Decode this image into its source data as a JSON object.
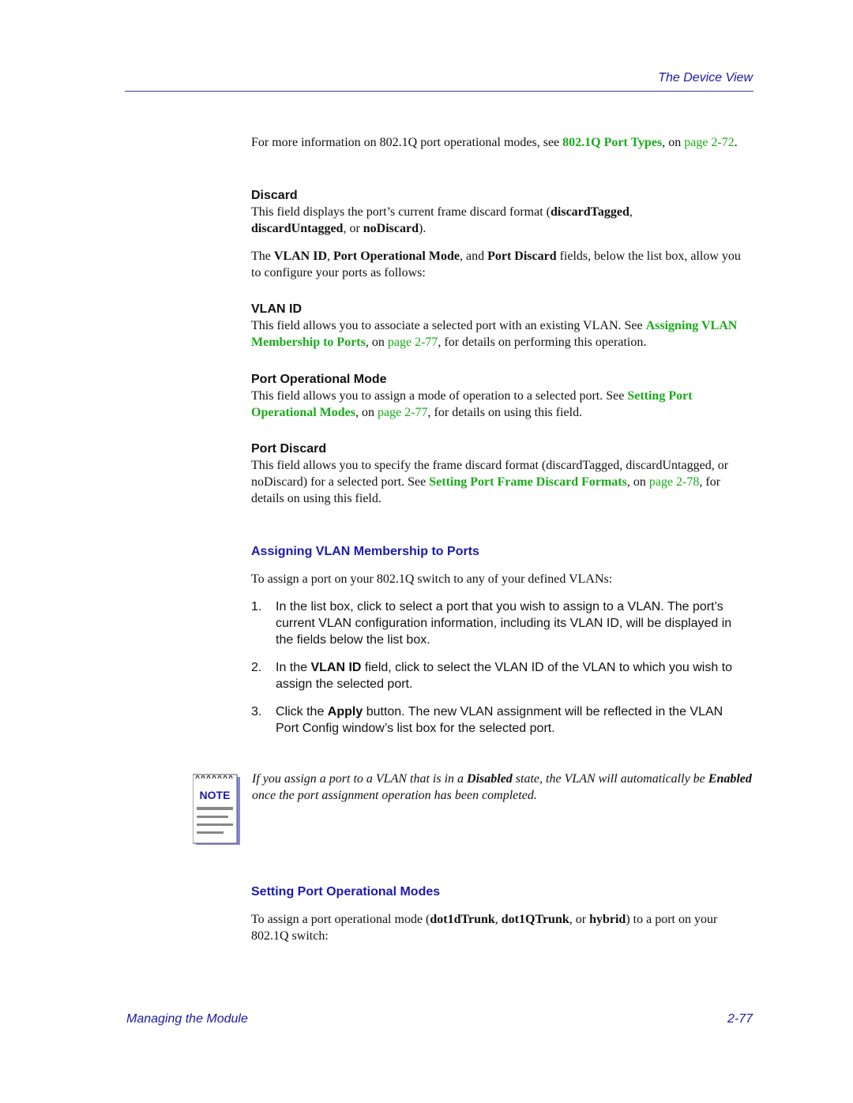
{
  "header": {
    "running_title": "The Device View"
  },
  "intro": {
    "text1": "For more information on 802.1Q port operational modes, see ",
    "link": "802.1Q Port Types",
    "text2": ", on ",
    "page_link": "page 2-72",
    "text3": "."
  },
  "discard": {
    "heading": "Discard",
    "t1": "This field displays the port’s current frame discard format (",
    "b1": "discardTagged",
    "t2": ", ",
    "b2": "discardUntagged",
    "t3": ", or ",
    "b3": "noDiscard",
    "t4": ")."
  },
  "fields_intro": {
    "t1": "The ",
    "b1": "VLAN ID",
    "t2": ", ",
    "b2": "Port Operational Mode",
    "t3": ", and ",
    "b3": "Port Discard",
    "t4": " fields, below the list box, allow you to configure your ports as follows:"
  },
  "vlan_id": {
    "heading": "VLAN ID",
    "t1": "This field allows you to associate a selected port with an existing VLAN. See ",
    "link": "Assigning VLAN Membership to Ports",
    "t2": ", on ",
    "page_link": "page 2-77",
    "t3": ", for details on performing this operation."
  },
  "port_op_mode": {
    "heading": "Port Operational Mode",
    "t1": "This field allows you to assign a mode of operation to a selected port. See ",
    "link": "Setting Port Operational Modes",
    "t2": ", on ",
    "page_link": "page 2-77",
    "t3": ", for details on using this field."
  },
  "port_discard": {
    "heading": "Port Discard",
    "t1": "This field allows you to specify the frame discard format (discardTagged, discardUntagged, or noDiscard) for a selected port. See ",
    "link": "Setting Port Frame Discard Formats",
    "t2": ", on ",
    "page_link": "page 2-78",
    "t3": ", for details on using this field."
  },
  "assigning": {
    "heading": "Assigning VLAN Membership to Ports",
    "intro": "To assign a port on your 802.1Q switch to any of your defined VLANs:",
    "steps": [
      {
        "num": "1.",
        "t1": "In the list box, click to select a port that you wish to assign to a VLAN. The port’s current VLAN configuration information, including its VLAN ID, will be displayed in the fields below the list box.",
        "b": "",
        "t2": ""
      },
      {
        "num": "2.",
        "t1": "In the ",
        "b": "VLAN ID",
        "t2": " field, click to select the VLAN ID of the VLAN to which you wish to assign the selected port."
      },
      {
        "num": "3.",
        "t1": "Click the ",
        "b": "Apply",
        "t2": " button. The new VLAN assignment will be reflected in the VLAN Port Config window’s list box for the selected port."
      }
    ]
  },
  "note": {
    "icon_label": "NOTE",
    "t1": "If you assign a port to a VLAN that is in a ",
    "b1": "Disabled",
    "t2": " state, the VLAN will automatically be ",
    "b2": "Enabled",
    "t3": " once the port assignment operation has been completed."
  },
  "setting_modes": {
    "heading": "Setting Port Operational Modes",
    "t1": "To assign a port operational mode (",
    "b1": "dot1dTrunk",
    "t2": ", ",
    "b2": "dot1QTrunk",
    "t3": ", or ",
    "b3": "hybrid",
    "t4": ") to a port on your 802.1Q switch:"
  },
  "footer": {
    "chapter": "Managing the Module",
    "page": "2-77"
  }
}
